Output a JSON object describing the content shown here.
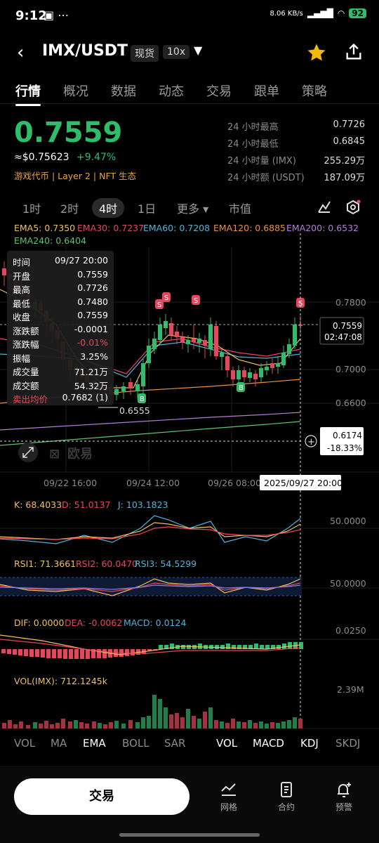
{
  "status": {
    "time": "9:12",
    "net": "8.06 KB/s",
    "battery": "92"
  },
  "header": {
    "pair": "IMX/USDT",
    "market_tag": "现货",
    "leverage_tag": "10x"
  },
  "tabs": [
    "行情",
    "概况",
    "数据",
    "动态",
    "交易",
    "跟单",
    "策略"
  ],
  "price": {
    "last": "0.7559",
    "usd": "≈$0.75623",
    "change": "+9.47%",
    "tags": "游戏代币 | Layer 2 | NFT 生态"
  },
  "stats": [
    {
      "label": "24 小时最高",
      "value": "0.7726"
    },
    {
      "label": "24 小时最低",
      "value": "0.6845"
    },
    {
      "label": "24 小时量 (IMX)",
      "value": "255.29万"
    },
    {
      "label": "24 小时额 (USDT)",
      "value": "187.09万"
    }
  ],
  "intervals": [
    "1时",
    "2时",
    "4时",
    "1日",
    "更多",
    "市值"
  ],
  "ema": {
    "ema5": "EMA5: 0.7350",
    "ema30": "EMA30: 0.7237",
    "ema60": "EMA60: 0.7208",
    "ema120": "EMA120: 0.6885",
    "ema200": "EMA200: 0.6532",
    "ema240": "EMA240: 0.6404"
  },
  "tooltip": [
    {
      "k": "时间",
      "v": "09/27 20:00"
    },
    {
      "k": "开盘",
      "v": "0.7559"
    },
    {
      "k": "最高",
      "v": "0.7726"
    },
    {
      "k": "最低",
      "v": "0.7480"
    },
    {
      "k": "收盘",
      "v": "0.7559"
    },
    {
      "k": "涨跌额",
      "v": "-0.0001"
    },
    {
      "k": "涨跌幅",
      "v": "-0.01%"
    },
    {
      "k": "振幅",
      "v": "3.25%"
    },
    {
      "k": "成交量",
      "v": "71.21万"
    },
    {
      "k": "成交额",
      "v": "54.32万"
    },
    {
      "k": "卖出均价",
      "v": "0.7682 (1)"
    }
  ],
  "main_axis": [
    "0.7800",
    "0.7000",
    "0.6600"
  ],
  "price_tag": {
    "price": "0.7559",
    "countdown": "02:47:08"
  },
  "cursor_tag": {
    "price": "0.6174",
    "pct": "-18.33%"
  },
  "low_label": "0.6555",
  "watermark": "欧易",
  "time_axis": [
    "09/22 16:00",
    "09/24 12:00",
    "09/26 08:00"
  ],
  "cursor_time": "2025/09/27 20:00",
  "kdj": {
    "k": "K: 68.4033",
    "d": "D: 51.0137",
    "j": "J: 103.1823",
    "axis": "50.0000"
  },
  "rsi": {
    "rsi1": "RSI1: 71.3661",
    "rsi2": "RSI2: 60.0470",
    "rsi3": "RSI3: 54.5299",
    "axis": "50.0000"
  },
  "macd": {
    "dif": "DIF: 0.0000",
    "dea": "DEA: -0.0062",
    "macd": "MACD: 0.0124",
    "axis": "0.0250"
  },
  "vol": {
    "label": "VOL(IMX): 712.1245k",
    "axis": "2.39M"
  },
  "indicators": [
    "VOL",
    "MA",
    "EMA",
    "BOLL",
    "SAR",
    "VOL",
    "MACD",
    "KDJ",
    "SKDJ"
  ],
  "bottom": {
    "trade": "交易",
    "grid": "网格",
    "contract": "合约",
    "alert": "预警"
  },
  "colors": {
    "up": "#2ebd6b",
    "down": "#e8455d",
    "ema5": "#f0c05a",
    "ema30": "#e8455d",
    "ema60": "#4fb3d9",
    "ema120": "#e8903d",
    "ema200": "#b57bd8",
    "ema240": "#5ec46b"
  }
}
